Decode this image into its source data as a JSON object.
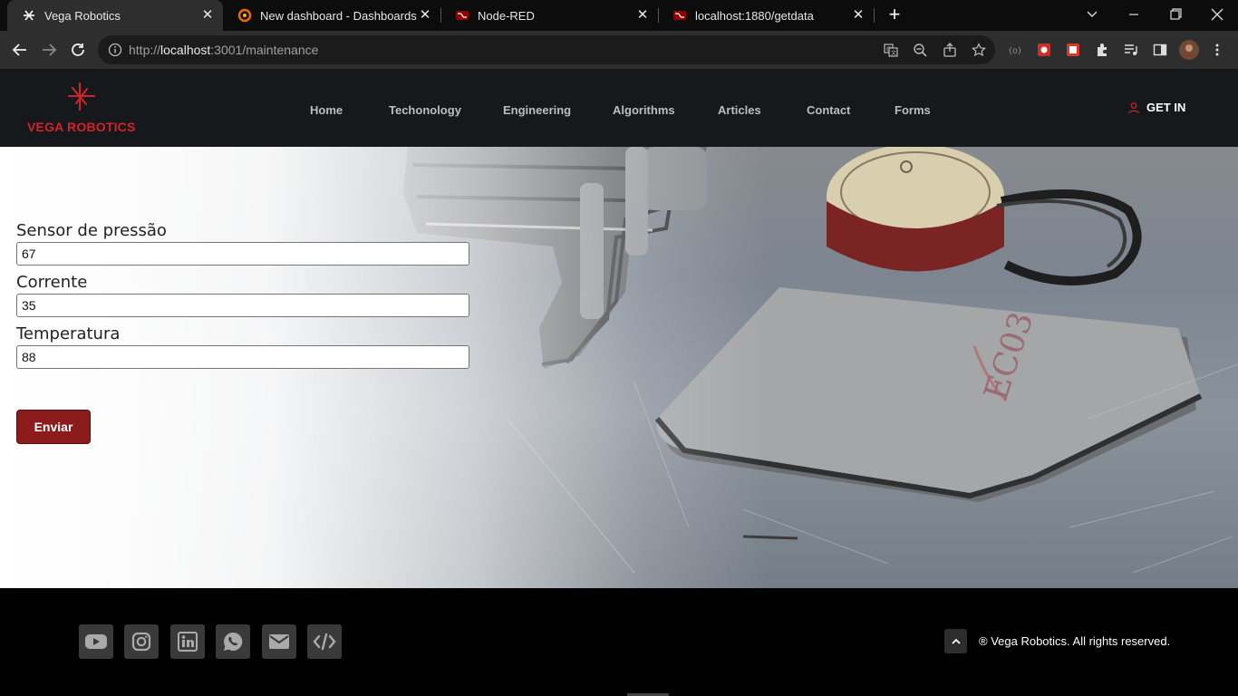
{
  "browser": {
    "tabs": [
      {
        "title": "Vega Robotics",
        "favicon": "vega-logo-icon",
        "active": true
      },
      {
        "title": "New dashboard - Dashboards - ",
        "favicon": "grafana-icon",
        "active": false
      },
      {
        "title": "Node-RED",
        "favicon": "node-red-icon",
        "active": false
      },
      {
        "title": "localhost:1880/getdata",
        "favicon": "node-red-icon",
        "active": false
      }
    ],
    "url_prefix": "http://",
    "url_host": "localhost",
    "url_rest": ":3001/maintenance"
  },
  "header": {
    "logo_text": "VEGA ROBOTICS",
    "nav": [
      "Home",
      "Techonology",
      "Engineering",
      "Algorithms",
      "Articles",
      "Contact",
      "Forms"
    ],
    "login_label": "GET IN"
  },
  "form": {
    "fields": [
      {
        "label": "Sensor de pressão",
        "value": "67"
      },
      {
        "label": "Corrente",
        "value": "35"
      },
      {
        "label": "Temperatura",
        "value": "88"
      }
    ],
    "submit_label": "Enviar"
  },
  "footer": {
    "social_icons": [
      "youtube-icon",
      "instagram-icon",
      "linkedin-icon",
      "whatsapp-icon",
      "email-icon",
      "code-icon"
    ],
    "copyright": "® Vega Robotics. All rights reserved."
  },
  "colors": {
    "brand_red": "#d2232a",
    "button_red": "#8c1b1b",
    "header_bg": "#16181b"
  }
}
